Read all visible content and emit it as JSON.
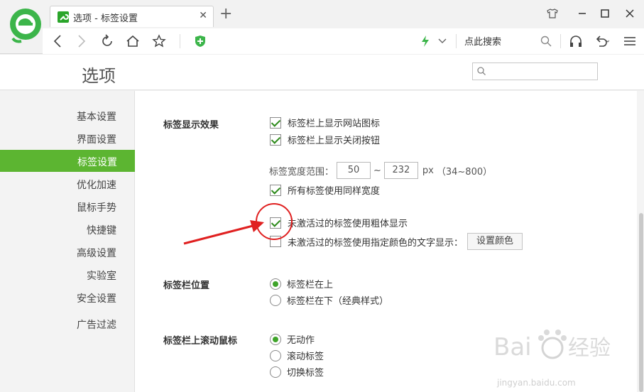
{
  "browser": {
    "tab_title": "选项 - 标签设置",
    "search_label": "点此搜索"
  },
  "options": {
    "title": "选项"
  },
  "sidebar": {
    "items": [
      {
        "label": "基本设置"
      },
      {
        "label": "界面设置"
      },
      {
        "label": "标签设置"
      },
      {
        "label": "优化加速"
      },
      {
        "label": "鼠标手势"
      },
      {
        "label": "快捷键"
      },
      {
        "label": "高级设置"
      },
      {
        "label": "实验室"
      },
      {
        "label": "安全设置"
      },
      {
        "label": "广告过滤"
      }
    ],
    "active_index": 2
  },
  "sections": {
    "display": {
      "title": "标签显示效果",
      "show_site_icon": {
        "label": "标签栏上显示网站图标",
        "checked": true
      },
      "show_close_button": {
        "label": "标签栏上显示关闭按钮",
        "checked": true
      },
      "width_range": {
        "label": "标签宽度范围：",
        "min": "50",
        "sep": "~",
        "max": "232",
        "unit": "px",
        "hint": "（34~800）"
      },
      "same_width": {
        "label": "所有标签使用同样宽度",
        "checked": true
      },
      "bold_inactive": {
        "label": "未激活过的标签使用粗体显示",
        "checked": true
      },
      "color_inactive": {
        "label": "未激活过的标签使用指定颜色的文字显示：",
        "checked": false
      },
      "set_color_button": "设置颜色"
    },
    "position": {
      "title": "标签栏位置",
      "options": [
        {
          "label": "标签栏在上",
          "selected": true
        },
        {
          "label": "标签栏在下（经典样式）",
          "selected": false
        }
      ]
    },
    "scroll": {
      "title": "标签栏上滚动鼠标",
      "options": [
        {
          "label": "无动作",
          "selected": true
        },
        {
          "label": "滚动标签",
          "selected": false
        },
        {
          "label": "切换标签",
          "selected": false
        }
      ]
    }
  },
  "watermark": {
    "text": "jingyan.baidu.com"
  },
  "colors": {
    "accent": "#5cb531",
    "annotation_red": "#e02020"
  }
}
